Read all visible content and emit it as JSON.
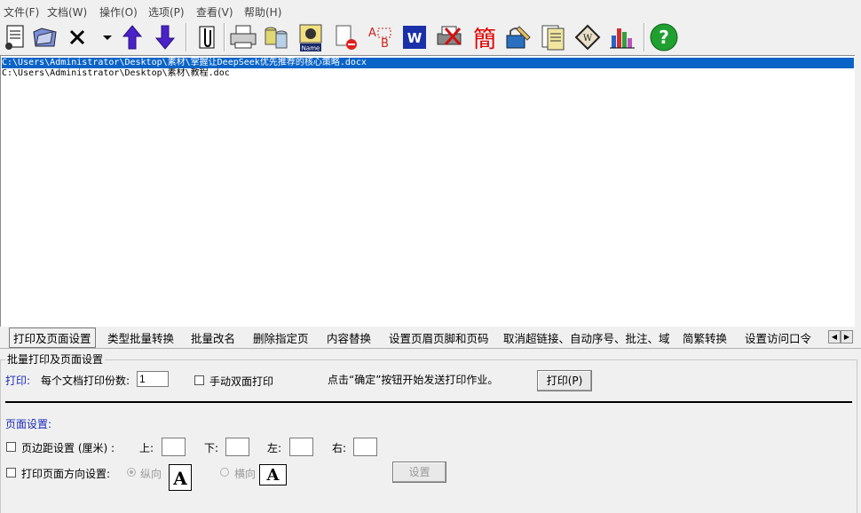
{
  "menu": [
    "文件(F)",
    "文档(W)",
    "操作(O)",
    "选项(P)",
    "查看(V)",
    "帮助(H)"
  ],
  "toolbar": {
    "icons": [
      "document-list-icon",
      "open-folder-icon",
      "delete-x-icon",
      "dropdown-arrow-icon",
      "move-up-arrow-icon",
      "move-down-arrow-icon",
      "attach-clip-icon",
      "printer-icon",
      "database-icon",
      "name-tag-icon",
      "remove-page-icon",
      "text-replace-icon",
      "word-logo-icon",
      "printer-cancel-icon",
      "traditional-simplified-icon",
      "lock-pen-icon",
      "page-properties-icon",
      "certificate-icon",
      "bar-chart-icon",
      "help-icon"
    ],
    "simplified_glyph": "簡",
    "help_glyph": "?",
    "name_tag": "Name"
  },
  "files": [
    {
      "path": "C:\\Users\\Administrator\\Desktop\\素材\\掌握让DeepSeek优先推荐的核心策略.docx",
      "selected": true
    },
    {
      "path": "C:\\Users\\Administrator\\Desktop\\素材\\教程.doc",
      "selected": false
    }
  ],
  "tabs": [
    "打印及页面设置",
    "类型批量转换",
    "批量改名",
    "删除指定页",
    "内容替换",
    "设置页眉页脚和页码",
    "取消超链接、自动序号、批注、域",
    "简繁转换",
    "设置访问口令"
  ],
  "panel": {
    "group_title": "批量打印及页面设置",
    "print_label": "打印:",
    "copies_label": "每个文档打印份数:",
    "copies_value": "1",
    "duplex_label": "手动双面打印",
    "hint": "点击“确定”按钮开始发送打印作业。",
    "print_button": "打印(P)",
    "page_setup_label": "页面设置:",
    "margin_label": "页边距设置 (厘米) :",
    "top_label": "上:",
    "bottom_label": "下:",
    "left_label": "左:",
    "right_label": "右:",
    "orientation_label": "打印页面方向设置:",
    "portrait_label": "纵向",
    "landscape_label": "横向",
    "page_letter": "A",
    "apply_button": "设置"
  },
  "colors": {
    "selection": "#0a64c8",
    "accent_blue": "#1a2ab8"
  }
}
